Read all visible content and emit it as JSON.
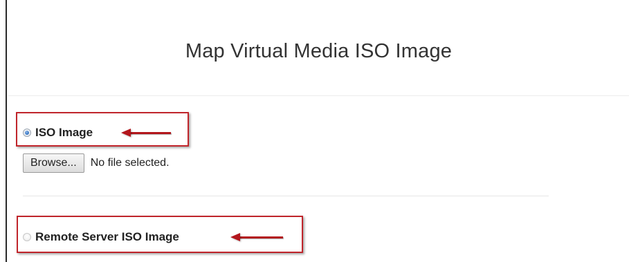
{
  "dialog": {
    "title": "Map Virtual Media ISO Image"
  },
  "iso_option": {
    "label": "ISO Image",
    "selected": true
  },
  "file_picker": {
    "button_label": "Browse...",
    "status_text": "No file selected."
  },
  "remote_option": {
    "label": "Remote Server ISO Image",
    "selected": false
  },
  "colors": {
    "annotation_red": "#c0252b",
    "radio_selected_blue": "#2f6fbf"
  }
}
